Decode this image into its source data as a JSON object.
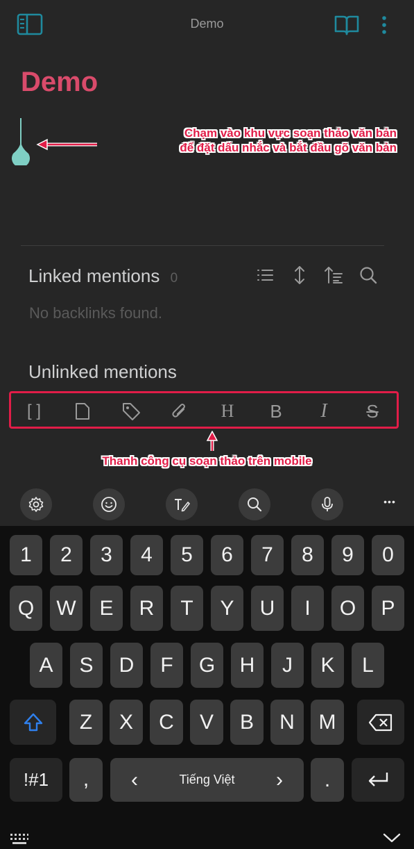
{
  "topbar": {
    "title": "Demo",
    "icons": [
      "sidebar-icon",
      "reading-view-icon",
      "more-vertical-icon"
    ]
  },
  "note": {
    "title": "Demo"
  },
  "annotations": {
    "cursor_hint_line1": "Chạm vào khu vực soạn thảo văn bản",
    "cursor_hint_line2": "để đặt dấu nhắc và bắt đầu gõ văn bản",
    "toolbar_hint": "Thanh công cụ soạn thảo trên mobile",
    "color": "#e11d48"
  },
  "backlinks": {
    "linked_title": "Linked mentions",
    "linked_count": "0",
    "empty_text": "No backlinks found.",
    "unlinked_title": "Unlinked mentions",
    "icons": [
      "list-icon",
      "expand-vertical-icon",
      "sort-icon",
      "search-icon"
    ]
  },
  "editor_toolbar": {
    "items": [
      "wikilink-icon",
      "file-icon",
      "tag-icon",
      "attachment-icon",
      "heading-icon",
      "bold-icon",
      "italic-icon",
      "strikethrough-icon"
    ],
    "heading_glyph": "H",
    "bold_glyph": "B",
    "italic_glyph": "I",
    "strike_glyph": "S",
    "wikilink_glyph": "[ ]"
  },
  "keyboard": {
    "suggestion_icons": [
      "settings-icon",
      "emoji-icon",
      "handwriting-icon",
      "search-icon",
      "microphone-icon",
      "more-horizontal-icon"
    ],
    "more_glyph": "•••",
    "row_numbers": [
      "1",
      "2",
      "3",
      "4",
      "5",
      "6",
      "7",
      "8",
      "9",
      "0"
    ],
    "row_qwerty": [
      "Q",
      "W",
      "E",
      "R",
      "T",
      "Y",
      "U",
      "I",
      "O",
      "P"
    ],
    "row_asdf": [
      "A",
      "S",
      "D",
      "F",
      "G",
      "H",
      "J",
      "K",
      "L"
    ],
    "row_zxcv": [
      "Z",
      "X",
      "C",
      "V",
      "B",
      "N",
      "M"
    ],
    "symbols_key": "!#1",
    "comma_key": ",",
    "space_label": "Tiếng Việt",
    "space_left_arrow": "‹",
    "space_right_arrow": "›",
    "period_key": ".",
    "accent": "#2f80ed"
  }
}
